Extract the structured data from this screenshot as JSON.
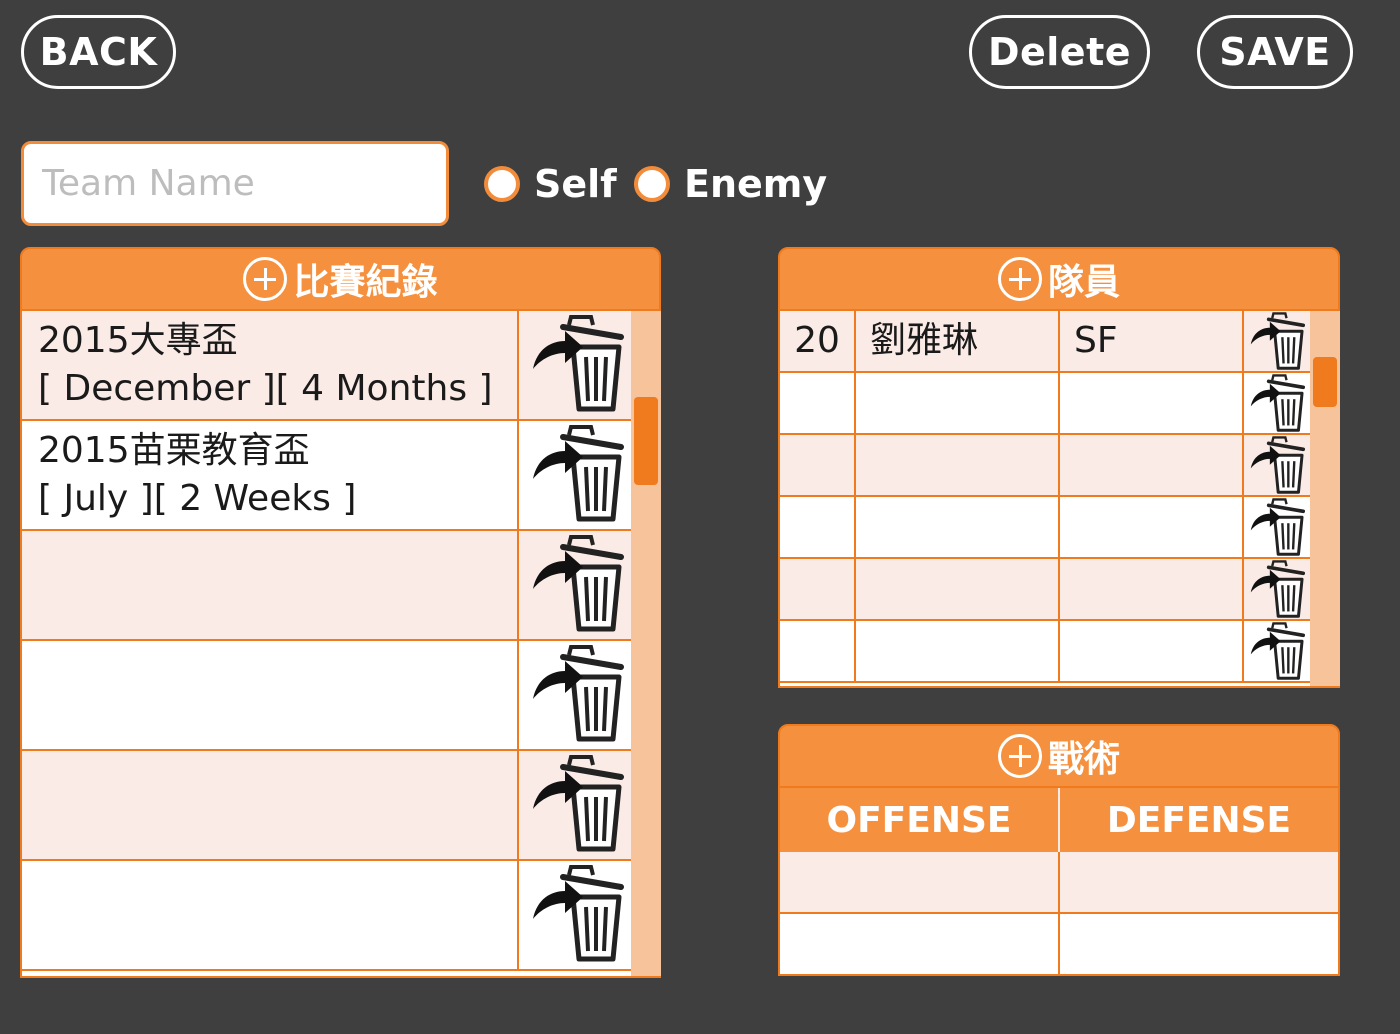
{
  "toolbar": {
    "back_label": "BACK",
    "delete_label": "Delete",
    "save_label": "SAVE"
  },
  "team": {
    "name_value": "",
    "name_placeholder": "Team Name",
    "side_options": [
      {
        "label": "Self"
      },
      {
        "label": "Enemy"
      }
    ]
  },
  "records": {
    "header_label": "比賽紀錄",
    "rows": [
      {
        "title": "2015大專盃",
        "detail": "[ December ][ 4 Months ]"
      },
      {
        "title": "2015苗栗教育盃",
        "detail": "[ July ][ 2 Weeks ]"
      },
      {
        "title": "",
        "detail": ""
      },
      {
        "title": "",
        "detail": ""
      },
      {
        "title": "",
        "detail": ""
      },
      {
        "title": "",
        "detail": ""
      }
    ]
  },
  "members": {
    "header_label": "隊員",
    "rows": [
      {
        "number": "20",
        "name": "劉雅琳",
        "position": "SF"
      },
      {
        "number": "",
        "name": "",
        "position": ""
      },
      {
        "number": "",
        "name": "",
        "position": ""
      },
      {
        "number": "",
        "name": "",
        "position": ""
      },
      {
        "number": "",
        "name": "",
        "position": ""
      },
      {
        "number": "",
        "name": "",
        "position": ""
      }
    ]
  },
  "tactics": {
    "header_label": "戰術",
    "offense_label": "OFFENSE",
    "defense_label": "DEFENSE",
    "rows": [
      {
        "offense": "",
        "defense": ""
      },
      {
        "offense": "",
        "defense": ""
      }
    ]
  },
  "icons": {
    "add": "plus-circle-icon",
    "remove_row": "trash-with-arrow-icon"
  },
  "colors": {
    "background": "#3f3f3f",
    "accent": "#f5903e",
    "row_tint": "#fbebe6"
  }
}
